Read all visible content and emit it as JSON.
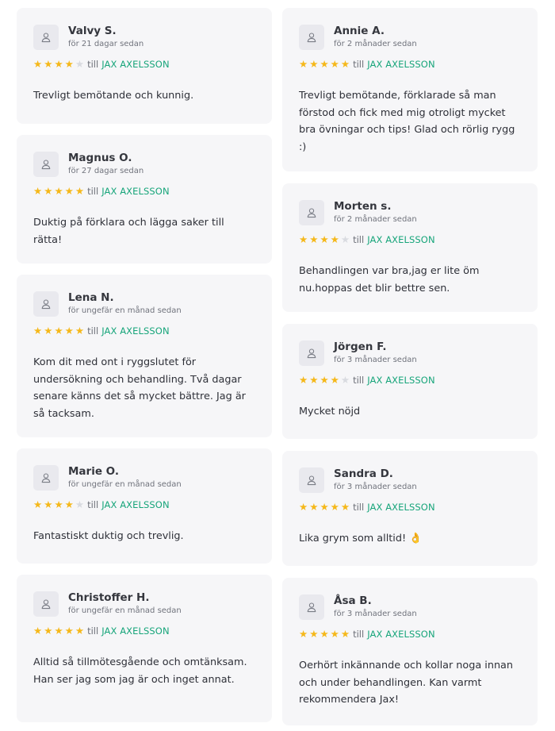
{
  "reviews": [
    {
      "name": "Valvy S.",
      "date": "för 21 dagar sedan",
      "rating": 4,
      "to_label": "till",
      "therapist": "JAX AXELSSON",
      "text": "Trevligt bemötande och kunnig."
    },
    {
      "name": "Magnus O.",
      "date": "för 27 dagar sedan",
      "rating": 5,
      "to_label": "till",
      "therapist": "JAX AXELSSON",
      "text": "Duktig på förklara och lägga saker till rätta!"
    },
    {
      "name": "Lena N.",
      "date": "för ungefär en månad sedan",
      "rating": 5,
      "to_label": "till",
      "therapist": "JAX AXELSSON",
      "text": "Kom dit med ont i ryggslutet för undersökning och behandling. Två dagar senare känns det så mycket bättre. Jag är så tacksam."
    },
    {
      "name": "Marie O.",
      "date": "för ungefär en månad sedan",
      "rating": 4,
      "to_label": "till",
      "therapist": "JAX AXELSSON",
      "text": "Fantastiskt duktig och trevlig."
    },
    {
      "name": "Christoffer H.",
      "date": "för ungefär en månad sedan",
      "rating": 5,
      "to_label": "till",
      "therapist": "JAX AXELSSON",
      "text": "Alltid så tillmötesgående och omtänksam. Han ser jag som jag är och inget annat."
    },
    {
      "name": "Annie A.",
      "date": "för 2 månader sedan",
      "rating": 5,
      "to_label": "till",
      "therapist": "JAX AXELSSON",
      "text": "Trevligt bemötande, förklarade så man förstod och fick med mig otroligt mycket bra övningar och tips! Glad och rörlig rygg :)"
    },
    {
      "name": "Morten s.",
      "date": "för 2 månader sedan",
      "rating": 4,
      "to_label": "till",
      "therapist": "JAX AXELSSON",
      "text": "Behandlingen var bra,jag er lite öm nu.hoppas det blir bettre sen."
    },
    {
      "name": "Jörgen F.",
      "date": "för 3 månader sedan",
      "rating": 4,
      "to_label": "till",
      "therapist": "JAX AXELSSON",
      "text": "Mycket nöjd"
    },
    {
      "name": "Sandra D.",
      "date": "för 3 månader sedan",
      "rating": 5,
      "to_label": "till",
      "therapist": "JAX AXELSSON",
      "text": "Lika grym som alltid!",
      "emoji": "👌"
    },
    {
      "name": "Åsa B.",
      "date": "för 3 månader sedan",
      "rating": 5,
      "to_label": "till",
      "therapist": "JAX AXELSSON",
      "text": "Oerhört inkännande och kollar noga innan och under behandlingen. Kan varmt rekommendera Jax!"
    }
  ],
  "colors": {
    "star_on": "#f5b81a",
    "star_off": "#d9dbe0",
    "therapist": "#17a57a",
    "card_bg": "#f6f6f8"
  },
  "icons": {
    "avatar": "user-icon",
    "star": "star-icon"
  }
}
